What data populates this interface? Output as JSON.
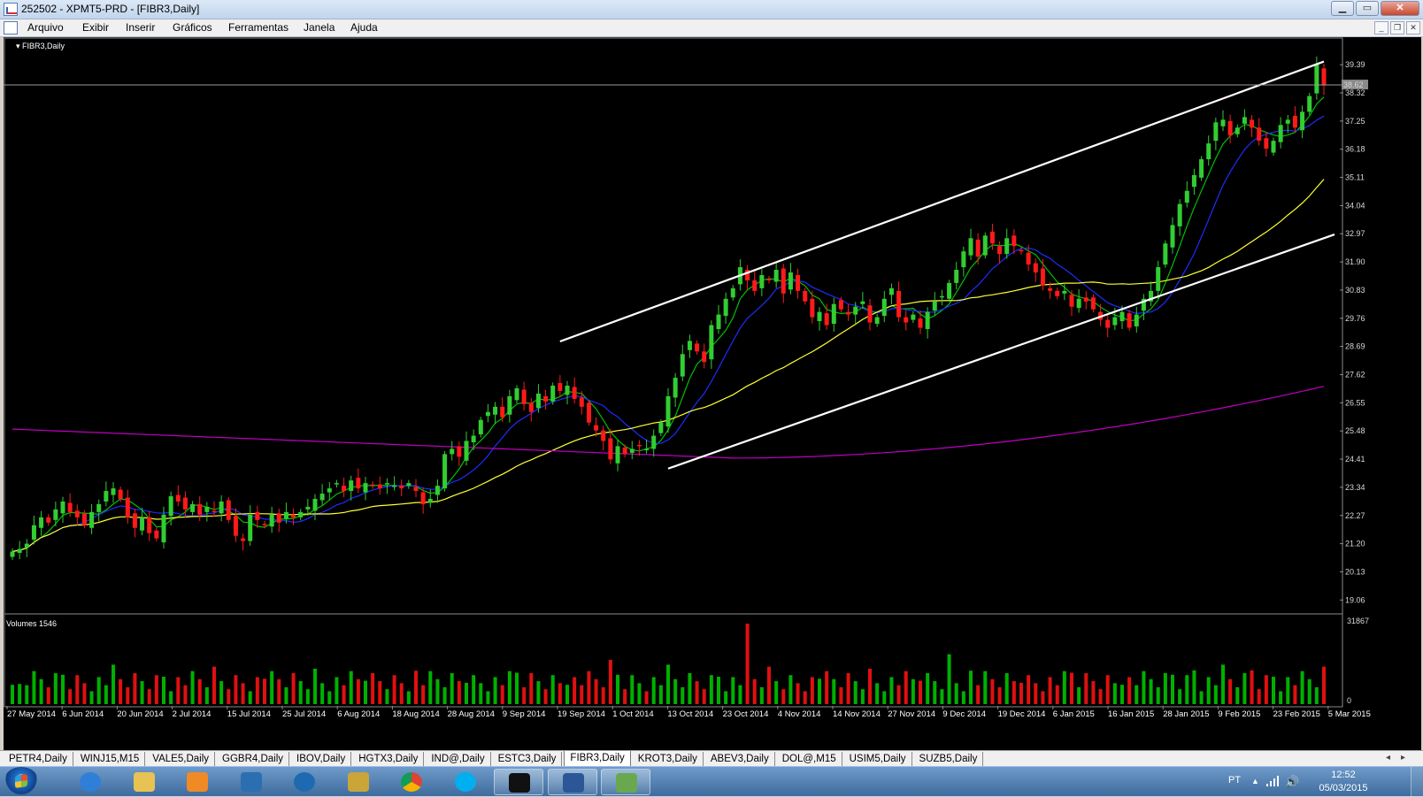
{
  "window": {
    "title": "252502 - XPMT5-PRD - [FIBR3,Daily]"
  },
  "menu": [
    "Arquivo",
    "Exibir",
    "Inserir",
    "Gráficos",
    "Ferramentas",
    "Janela",
    "Ajuda"
  ],
  "chart": {
    "symbol_label": "FIBR3,Daily",
    "volume_label": "Volumes 1546",
    "current_price_label": "38.62",
    "volume_axis_max": "31867",
    "volume_axis_min": "0",
    "colors": {
      "background": "#000000",
      "up_candle": "#32cd32",
      "down_candle": "#ff1a1a",
      "ma_fast": "#00c000",
      "ma_mid": "#1e2cff",
      "ma_slow": "#ffff33",
      "ma_long": "#c000c0",
      "trendline": "#ffffff",
      "axis_text": "#d8d8d8"
    }
  },
  "chart_data": {
    "type": "candlestick",
    "symbol": "FIBR3",
    "timeframe": "Daily",
    "x_tick_labels": [
      "27 May 2014",
      "6 Jun 2014",
      "20 Jun 2014",
      "2 Jul 2014",
      "15 Jul 2014",
      "25 Jul 2014",
      "6 Aug 2014",
      "18 Aug 2014",
      "28 Aug 2014",
      "9 Sep 2014",
      "19 Sep 2014",
      "1 Oct 2014",
      "13 Oct 2014",
      "23 Oct 2014",
      "4 Nov 2014",
      "14 Nov 2014",
      "27 Nov 2014",
      "9 Dec 2014",
      "19 Dec 2014",
      "6 Jan 2015",
      "16 Jan 2015",
      "28 Jan 2015",
      "9 Feb 2015",
      "23 Feb 2015",
      "5 Mar 2015"
    ],
    "y_tick_labels": [
      "39.39",
      "38.32",
      "37.25",
      "36.18",
      "35.11",
      "34.04",
      "32.97",
      "31.90",
      "30.83",
      "29.76",
      "28.69",
      "27.62",
      "26.55",
      "25.48",
      "24.41",
      "23.34",
      "22.27",
      "21.20",
      "20.13",
      "19.06"
    ],
    "ylim": [
      18.6,
      40.1
    ],
    "last_price": 38.62,
    "closes": [
      20.9,
      21.0,
      21.2,
      21.9,
      22.2,
      22.0,
      22.5,
      22.8,
      22.4,
      22.2,
      21.9,
      22.4,
      22.7,
      23.2,
      23.3,
      22.9,
      22.2,
      21.8,
      22.2,
      21.6,
      21.4,
      22.3,
      23.0,
      22.8,
      22.5,
      22.7,
      22.3,
      22.6,
      22.4,
      22.8,
      22.1,
      21.5,
      21.3,
      22.3,
      22.1,
      21.9,
      22.3,
      22.0,
      22.4,
      22.2,
      22.4,
      22.6,
      22.9,
      23.1,
      23.3,
      23.5,
      23.2,
      23.6,
      23.3,
      23.5,
      23.4,
      23.3,
      23.5,
      23.4,
      23.3,
      23.5,
      23.2,
      22.7,
      22.9,
      23.4,
      24.6,
      24.8,
      24.5,
      25.1,
      25.3,
      25.9,
      26.2,
      26.4,
      26.0,
      26.8,
      27.1,
      26.5,
      26.2,
      26.9,
      26.6,
      27.2,
      27.0,
      27.2,
      26.7,
      26.4,
      25.8,
      25.5,
      25.1,
      24.4,
      24.9,
      24.6,
      24.8,
      24.9,
      24.8,
      25.3,
      25.8,
      26.8,
      27.5,
      28.4,
      28.9,
      28.5,
      28.1,
      29.5,
      29.9,
      30.5,
      30.9,
      31.7,
      31.2,
      30.8,
      31.4,
      31.2,
      31.6,
      30.7,
      31.5,
      30.8,
      30.4,
      29.8,
      30.0,
      29.5,
      30.3,
      30.1,
      29.9,
      30.2,
      30.4,
      29.6,
      29.8,
      30.5,
      30.9,
      29.8,
      29.6,
      29.9,
      29.4,
      30.0,
      30.4,
      30.6,
      31.1,
      31.6,
      32.3,
      32.8,
      32.1,
      32.9,
      32.6,
      32.2,
      32.8,
      32.5,
      32.3,
      31.8,
      31.5,
      31.0,
      30.8,
      30.6,
      30.8,
      30.2,
      30.5,
      30.4,
      30.1,
      29.7,
      29.4,
      29.8,
      30.0,
      29.4,
      29.9,
      30.5,
      30.8,
      31.7,
      32.6,
      33.3,
      34.1,
      34.6,
      35.2,
      35.8,
      36.4,
      37.2,
      37.3,
      36.7,
      37.0,
      37.4,
      37.0,
      36.5,
      36.2,
      36.5,
      37.1,
      37.3,
      37.0,
      37.6,
      38.2,
      39.4,
      38.6
    ],
    "series": [
      {
        "name": "MA fast",
        "color": "#00c000"
      },
      {
        "name": "MA mid",
        "color": "#1e2cff"
      },
      {
        "name": "MA slow",
        "color": "#ffff33"
      },
      {
        "name": "MA long",
        "color": "#c000c0"
      }
    ],
    "trendlines": [
      {
        "from": [
          "19 Sep 2014",
          28.88
        ],
        "to": [
          "5 Mar 2015",
          39.51
        ]
      },
      {
        "from": [
          "13 Oct 2014",
          24.05
        ],
        "to": [
          "5 Mar 2015",
          32.8
        ]
      }
    ]
  },
  "tabs": [
    {
      "label": "PETR4,Daily"
    },
    {
      "label": "WINJ15,M15"
    },
    {
      "label": "VALE5,Daily"
    },
    {
      "label": "GGBR4,Daily"
    },
    {
      "label": "IBOV,Daily"
    },
    {
      "label": "HGTX3,Daily"
    },
    {
      "label": "IND@,Daily"
    },
    {
      "label": "ESTC3,Daily"
    },
    {
      "label": "FIBR3,Daily",
      "active": true
    },
    {
      "label": "KROT3,Daily"
    },
    {
      "label": "ABEV3,Daily"
    },
    {
      "label": "DOL@,M15"
    },
    {
      "label": "USIM5,Daily"
    },
    {
      "label": "SUZB5,Daily"
    }
  ],
  "taskbar": {
    "apps": [
      {
        "name": "internet-explorer-icon",
        "color": "#2f7fd8"
      },
      {
        "name": "file-explorer-icon",
        "color": "#e8c253"
      },
      {
        "name": "media-player-icon",
        "color": "#f08a24"
      },
      {
        "name": "messenger-icon",
        "color": "#2b6fb0"
      },
      {
        "name": "hp-icon",
        "color": "#1d6ab0"
      },
      {
        "name": "archive-icon",
        "color": "#c9a53a"
      },
      {
        "name": "chrome-icon",
        "color": "#db4437"
      },
      {
        "name": "skype-icon",
        "color": "#00aff0"
      },
      {
        "name": "xp-trading-icon",
        "color": "#111111"
      },
      {
        "name": "word-icon",
        "color": "#2b5797"
      },
      {
        "name": "metatrader-icon",
        "color": "#6aa84f"
      }
    ],
    "lang": "PT",
    "time": "12:52",
    "date": "05/03/2015"
  }
}
